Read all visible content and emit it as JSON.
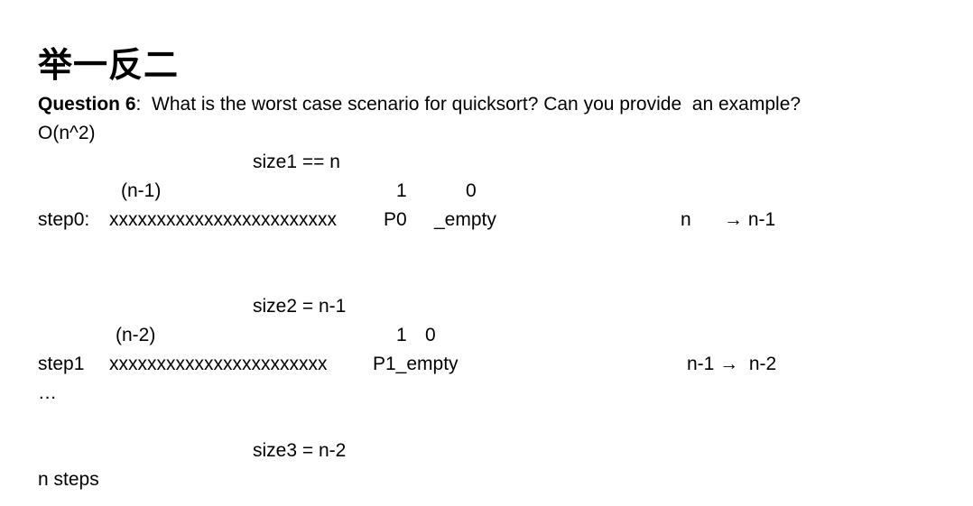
{
  "title": "举一反二",
  "question": {
    "label": "Question 6",
    "text": ":  What is the worst case scenario for quicksort? Can you provide  an example?"
  },
  "complexity": "O(n^2)",
  "step0": {
    "size": "size1 == n",
    "left_count": "(n-1)",
    "pivot_count": "1",
    "right_count": "0",
    "label": "step0:",
    "elements": "xxxxxxxxxxxxxxxxxxxxxxxx",
    "pivot": "P0",
    "right": "_empty",
    "transition_from": "n",
    "transition_to": "→ n-1"
  },
  "step1": {
    "size": "size2 = n-1",
    "left_count": "(n-2)",
    "pivot_count": "1",
    "right_count": "0",
    "label": "step1",
    "elements": "xxxxxxxxxxxxxxxxxxxxxxx",
    "pivot_and_right": "P1_empty",
    "transition": "n-1 →  n-2"
  },
  "ellipsis": "…",
  "step2": {
    "size": "size3 = n-2"
  },
  "summary": "n steps"
}
